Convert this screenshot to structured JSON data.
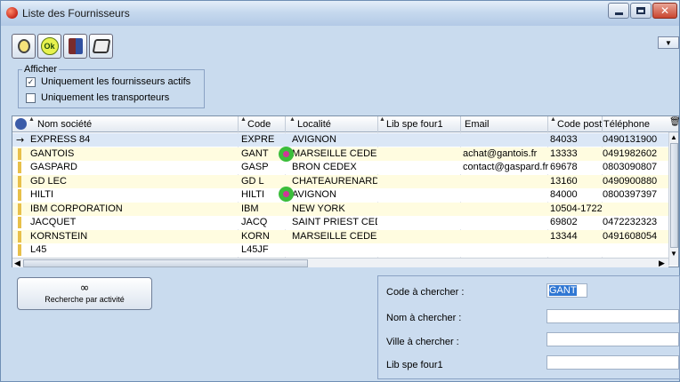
{
  "window": {
    "title": "Liste des Fournisseurs"
  },
  "toolbar": {
    "ok_label": "Ok",
    "buttons": [
      "new-icon",
      "ok-icon",
      "exit-icon",
      "print-icon"
    ]
  },
  "filter": {
    "legend": "Afficher",
    "actifs_label": "Uniquement les fournisseurs actifs",
    "actifs_checked": true,
    "transporteurs_label": "Uniquement les transporteurs",
    "transporteurs_checked": false
  },
  "grid": {
    "columns": {
      "nom": "Nom société",
      "code": "Code",
      "localite": "Localité",
      "lib": "Lib spe four1",
      "email": "Email",
      "cp": "Code post",
      "tel": "Téléphone"
    },
    "rows": [
      {
        "nom": "EXPRESS 84",
        "code": "EXPRE",
        "localite": "AVIGNON",
        "lib": "",
        "email": "",
        "cp": "84033",
        "tel": "0490131900"
      },
      {
        "nom": "GANTOIS",
        "code": "GANT",
        "localite": "MARSEILLE CEDEX",
        "lib": "",
        "email": "achat@gantois.fr",
        "cp": "13333",
        "tel": "0491982602"
      },
      {
        "nom": "GASPARD",
        "code": "GASP",
        "localite": "BRON CEDEX",
        "lib": "",
        "email": "contact@gaspard.fr",
        "cp": "69678",
        "tel": "0803090807"
      },
      {
        "nom": "GD LEC",
        "code": "GD L",
        "localite": "CHATEAURENARD",
        "lib": "",
        "email": "",
        "cp": "13160",
        "tel": "0490900880"
      },
      {
        "nom": "HILTI",
        "code": "HILTI",
        "localite": "AVIGNON",
        "lib": "",
        "email": "",
        "cp": "84000",
        "tel": "0800397397"
      },
      {
        "nom": "IBM CORPORATION",
        "code": "IBM",
        "localite": "NEW YORK",
        "lib": "",
        "email": "",
        "cp": "10504-1722",
        "tel": ""
      },
      {
        "nom": "JACQUET",
        "code": "JACQ",
        "localite": "SAINT PRIEST CEDEX",
        "lib": "",
        "email": "",
        "cp": "69802",
        "tel": "0472232323"
      },
      {
        "nom": "KORNSTEIN",
        "code": "KORN",
        "localite": "MARSEILLE CEDEX",
        "lib": "",
        "email": "",
        "cp": "13344",
        "tel": "0491608054"
      },
      {
        "nom": "L45",
        "code": "L45JF",
        "localite": "",
        "lib": "",
        "email": "",
        "cp": "",
        "tel": ""
      }
    ],
    "current_row_marker": "→"
  },
  "activity_button": {
    "label": "Recherche par activité",
    "icon": "binoculars-icon"
  },
  "search": {
    "code_label": "Code à chercher :",
    "code_value": "GANT",
    "nom_label": "Nom à chercher :",
    "nom_value": "",
    "ville_label": "Ville à chercher :",
    "ville_value": "",
    "lib_label": "Lib spe four1",
    "lib_value": ""
  },
  "colors": {
    "window_bg": "#c9dbee",
    "selected_row": "#dbe7f6",
    "alt_row": "#fffce0",
    "indicator": "#e8c04a",
    "selection_highlight": "#3077d3"
  }
}
